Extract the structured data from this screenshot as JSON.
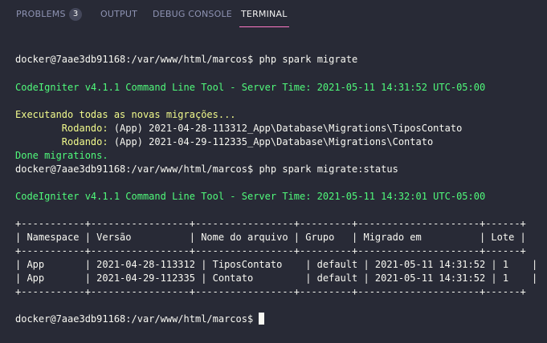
{
  "tabs": [
    {
      "label": "PROBLEMS",
      "badge": "3"
    },
    {
      "label": "OUTPUT"
    },
    {
      "label": "DEBUG CONSOLE"
    },
    {
      "label": "TERMINAL"
    }
  ],
  "terminal": {
    "prompt": "docker@7aae3db91168:/var/www/html/marcos$",
    "cmd1": " php spark migrate",
    "banner1": "CodeIgniter v4.1.1 Command Line Tool - Server Time: 2021-05-11 14:31:52 UTC-05:00",
    "executing": "Executando todas as novas migrações...",
    "rodando_label": "Rodando:",
    "rodando1": " (App) 2021-04-28-113312_App\\Database\\Migrations\\TiposContato",
    "rodando2": " (App) 2021-04-29-112335_App\\Database\\Migrations\\Contato",
    "done": "Done migrations.",
    "cmd2": " php spark migrate:status",
    "banner2": "CodeIgniter v4.1.1 Command Line Tool - Server Time: 2021-05-11 14:32:01 UTC-05:00",
    "table_border": "+-----------+-----------------+-----------------+---------+---------------------+------+",
    "table_header": "| Namespace | Versão          | Nome do arquivo | Grupo   | Migrado em          | Lote |",
    "table_row1": "| App       | 2021-04-28-113312 | TiposContato    | default | 2021-05-11 14:31:52 | 1    |",
    "table_row2": "| App       | 2021-04-29-112335 | Contato         | default | 2021-05-11 14:31:52 | 1    |",
    "final_prompt": "docker@7aae3db91168:/var/www/html/marcos$"
  }
}
